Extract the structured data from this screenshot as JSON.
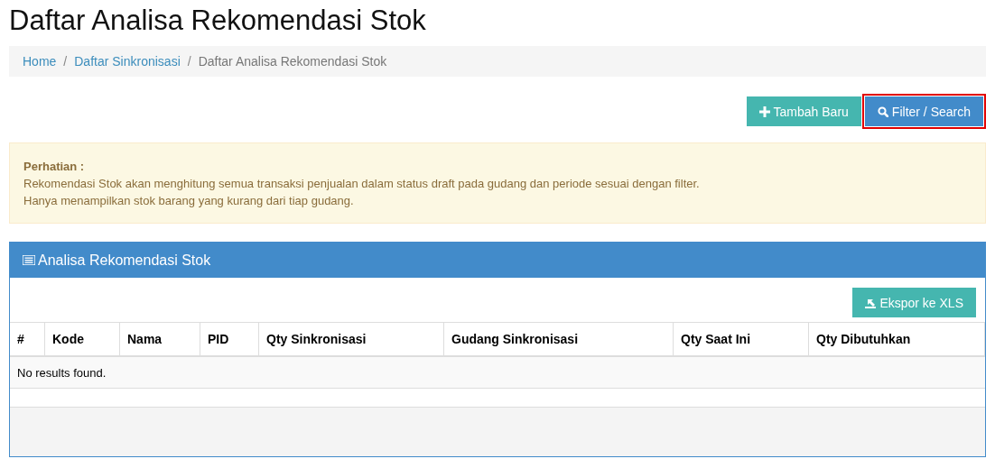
{
  "title": "Daftar Analisa Rekomendasi Stok",
  "breadcrumb_separator": "/",
  "breadcrumb": [
    {
      "label": "Home",
      "kind": "link"
    },
    {
      "label": "Daftar Sinkronisasi",
      "kind": "link"
    },
    {
      "label": "Daftar Analisa Rekomendasi Stok",
      "kind": "current"
    }
  ],
  "actions": [
    {
      "label": "Tambah Baru",
      "kind": "add",
      "highlighted": false
    },
    {
      "label": "Filter / Search",
      "kind": "search",
      "highlighted": true
    }
  ],
  "alert": {
    "heading": "Perhatian :",
    "lines": [
      "Rekomendasi Stok akan menghitung semua transaksi penjualan dalam status draft pada gudang dan periode sesuai dengan filter.",
      "Hanya menampilkan stok barang yang kurang dari tiap gudang."
    ]
  },
  "panel": {
    "title": "Analisa Rekomendasi Stok",
    "export_button": "Ekspor ke XLS",
    "table": {
      "columns": [
        "#",
        "Kode",
        "Nama",
        "PID",
        "Qty Sinkronisasi",
        "Gudang Sinkronisasi",
        "Qty Saat Ini",
        "Qty Dibutuhkan"
      ],
      "empty_message": "No results found."
    }
  }
}
